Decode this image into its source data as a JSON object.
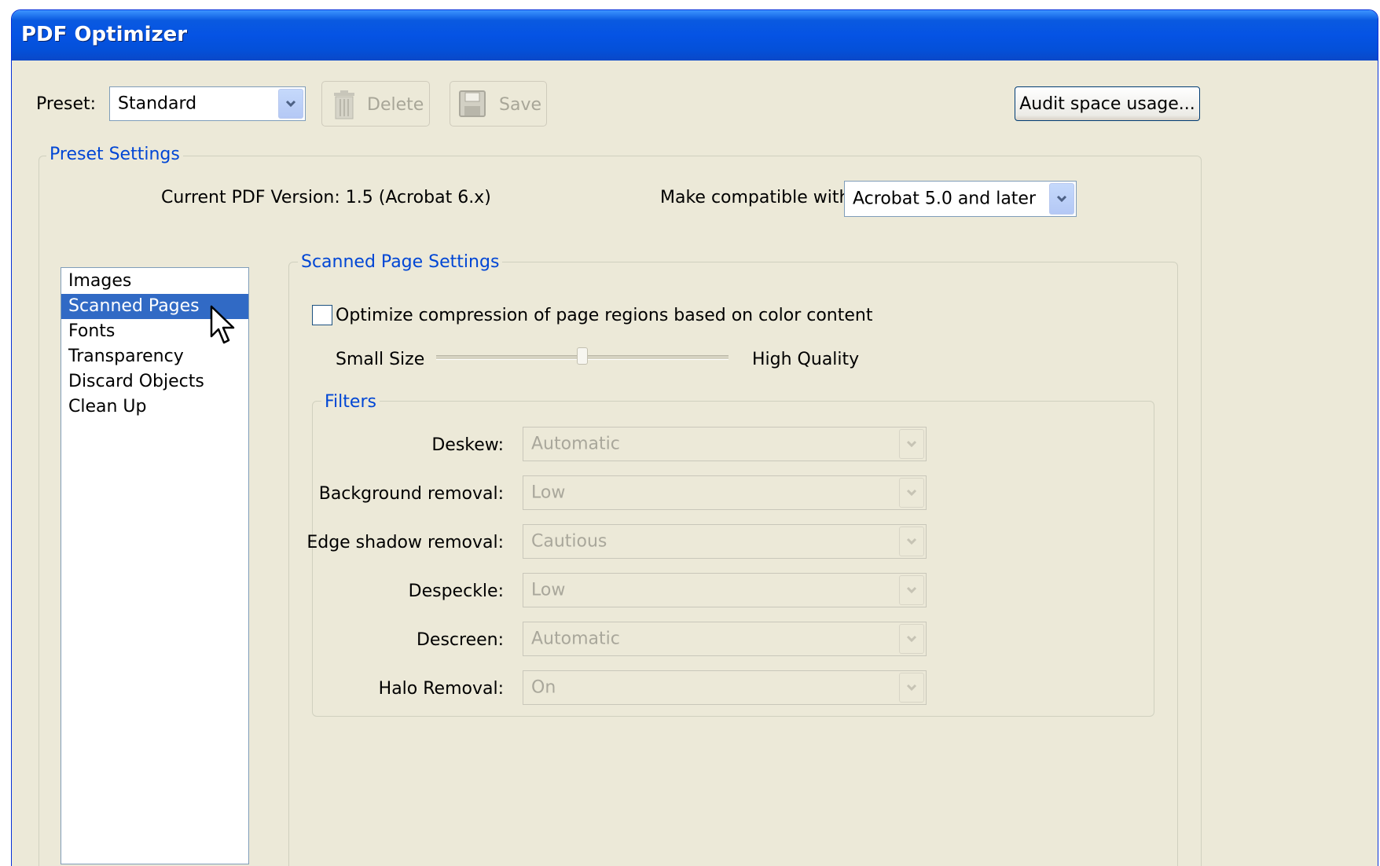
{
  "window": {
    "title": "PDF Optimizer"
  },
  "preset": {
    "label": "Preset:",
    "value": "Standard",
    "delete_label": "Delete",
    "save_label": "Save",
    "audit_label": "Audit space usage..."
  },
  "preset_settings": {
    "legend": "Preset Settings",
    "current_version": "Current PDF Version: 1.5 (Acrobat 6.x)",
    "compat_label": "Make compatible with:",
    "compat_value": "Acrobat 5.0 and later"
  },
  "categories": {
    "items": [
      {
        "label": "Images"
      },
      {
        "label": "Scanned Pages",
        "selected": true
      },
      {
        "label": "Fonts"
      },
      {
        "label": "Transparency"
      },
      {
        "label": "Discard Objects"
      },
      {
        "label": "Clean Up"
      }
    ]
  },
  "scanned": {
    "legend": "Scanned Page Settings",
    "optimize_label": "Optimize compression of page regions based on color content",
    "optimize_checked": false,
    "slider_min_label": "Small Size",
    "slider_max_label": "High Quality",
    "slider_value": 0.5
  },
  "filters": {
    "legend": "Filters",
    "rows": [
      {
        "label": "Deskew:",
        "value": "Automatic"
      },
      {
        "label": "Background removal:",
        "value": "Low"
      },
      {
        "label": "Edge shadow removal:",
        "value": "Cautious"
      },
      {
        "label": "Despeckle:",
        "value": "Low"
      },
      {
        "label": "Descreen:",
        "value": "Automatic"
      },
      {
        "label": "Halo Removal:",
        "value": "On"
      }
    ]
  },
  "colors": {
    "title_bar": "#0553e4",
    "selection": "#316ac5",
    "legend_text": "#0046d5",
    "dialog_bg": "#ece9d8"
  }
}
